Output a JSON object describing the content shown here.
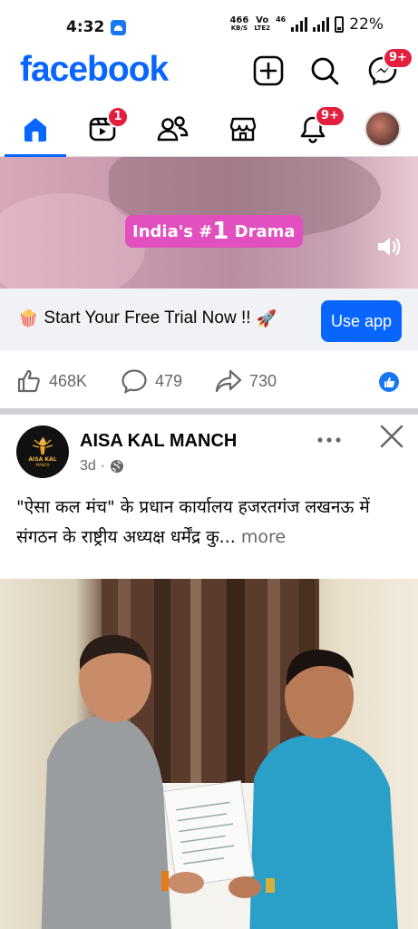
{
  "status": {
    "time": "4:32",
    "net_speed_value": "466",
    "net_speed_unit": "KB/S",
    "volte_top": "Vo",
    "volte_bottom": "LTE2",
    "network": "46",
    "battery": "22%"
  },
  "header": {
    "logo": "facebook",
    "messenger_badge": "9+"
  },
  "tabs": {
    "video_badge": "1",
    "notifications_badge": "9+"
  },
  "ad": {
    "pill_prefix": "India's #",
    "pill_number": "1",
    "pill_suffix": "Drama",
    "cta_text": "Start Your Free Trial Now !!",
    "cta_button": "Use app",
    "likes": "468K",
    "comments": "479",
    "shares": "730"
  },
  "post": {
    "page_name": "AISA KAL MANCH",
    "avatar_text_top": "AISA KAL",
    "avatar_text_bottom": "MANCH",
    "time": "3d",
    "separator": "·",
    "caption": "\"ऐसा कल मंच\" के प्रधान कार्यालय हजरतगंज लखनऊ में संगठन के राष्ट्रीय अध्यक्ष धर्मेंद्र कु...",
    "more": "more"
  },
  "colors": {
    "brand": "#0866ff",
    "badge": "#e41e3f",
    "pill": "#e24fbf"
  }
}
